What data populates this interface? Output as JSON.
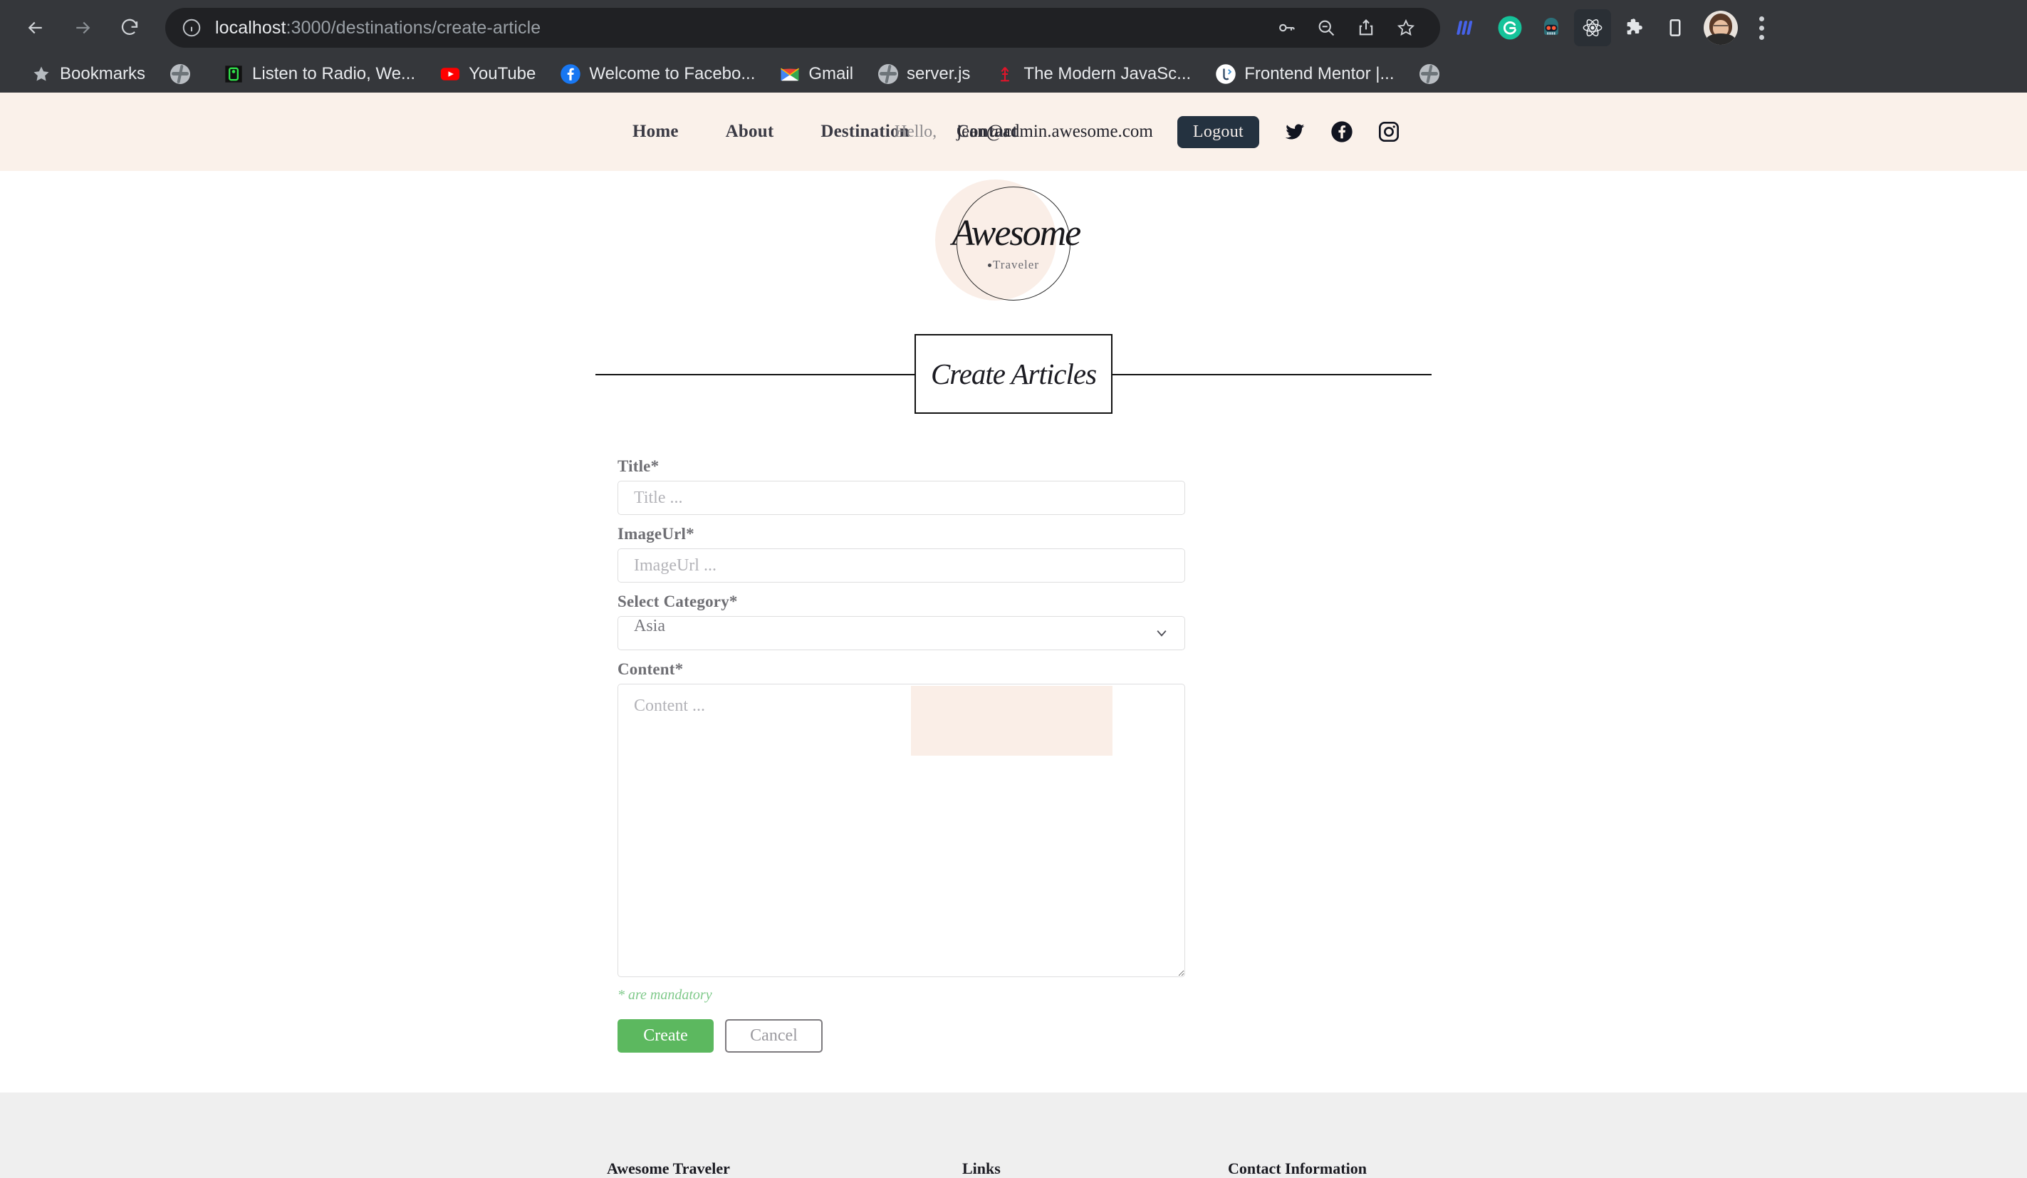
{
  "browser": {
    "back_icon": "back-arrow-icon",
    "forward_icon": "forward-arrow-icon",
    "reload_icon": "reload-icon",
    "site_info_icon": "site-info-icon",
    "url_host": "localhost",
    "url_path": ":3000/destinations/create-article",
    "omnibox_actions": [
      "password-key-icon",
      "zoom-out-icon",
      "share-icon",
      "bookmark-star-icon"
    ],
    "extensions": [
      "extension-blue-bars-icon",
      "grammarly-icon",
      "extension-robot-icon",
      "react-devtools-icon",
      "extensions-puzzle-icon",
      "reading-list-icon"
    ],
    "profile_icon": "profile-avatar",
    "menu_icon": "three-dot-menu-icon"
  },
  "bookmarks": {
    "label": "Bookmarks",
    "star_icon": "bookmark-star-icon",
    "items": [
      {
        "label": "",
        "icon": "globe-icon"
      },
      {
        "label": "Listen to Radio, We...",
        "icon": "radio-icon"
      },
      {
        "label": "YouTube",
        "icon": "youtube-icon"
      },
      {
        "label": "Welcome to Facebo...",
        "icon": "facebook-icon"
      },
      {
        "label": "Gmail",
        "icon": "gmail-icon"
      },
      {
        "label": "server.js",
        "icon": "globe-icon"
      },
      {
        "label": "The Modern JavaSc...",
        "icon": "javascript-info-icon"
      },
      {
        "label": "Frontend Mentor |...",
        "icon": "frontend-mentor-icon"
      },
      {
        "label": "",
        "icon": "globe-icon"
      }
    ]
  },
  "header": {
    "nav": [
      "Home",
      "About",
      "Destination",
      "Contact"
    ],
    "greeting": "Hello,",
    "user_email": "jean@admin.awesome.com",
    "logout_label": "Logout",
    "socials": [
      "twitter-icon",
      "facebook-icon",
      "instagram-icon"
    ],
    "bg_color": "#faf1ea"
  },
  "logo": {
    "name": "Awesome",
    "subtitle": "Traveler"
  },
  "section": {
    "title": "Create Articles"
  },
  "form": {
    "fields": [
      {
        "label": "Title*",
        "placeholder": "Title ...",
        "value": "",
        "type": "text"
      },
      {
        "label": "ImageUrl*",
        "placeholder": "ImageUrl ...",
        "value": "",
        "type": "text"
      },
      {
        "label": "Select Category*",
        "selected": "Asia",
        "type": "select"
      },
      {
        "label": "Content*",
        "placeholder": "Content ...",
        "value": "",
        "type": "textarea"
      }
    ],
    "mandatory_note": "* are mandatory",
    "create_label": "Create",
    "cancel_label": "Cancel",
    "create_color": "#5cb85f",
    "note_color": "#7fc98a"
  },
  "footer": {
    "columns": [
      "Awesome Traveler",
      "Links",
      "Contact Information"
    ],
    "bg_color": "#efefef"
  }
}
